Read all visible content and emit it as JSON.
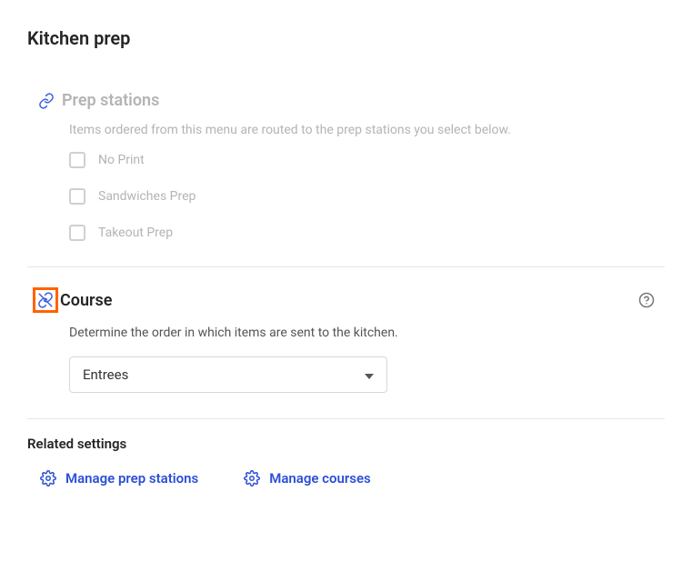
{
  "page": {
    "title": "Kitchen prep"
  },
  "prepStations": {
    "title": "Prep stations",
    "description": "Items ordered from this menu are routed to the prep stations you select below.",
    "options": [
      {
        "label": "No Print"
      },
      {
        "label": "Sandwiches Prep"
      },
      {
        "label": "Takeout Prep"
      }
    ]
  },
  "course": {
    "title": "Course",
    "description": "Determine the order in which items are sent to the kitchen.",
    "selected": "Entrees"
  },
  "related": {
    "heading": "Related settings",
    "links": {
      "prep": "Manage prep stations",
      "courses": "Manage courses"
    }
  }
}
